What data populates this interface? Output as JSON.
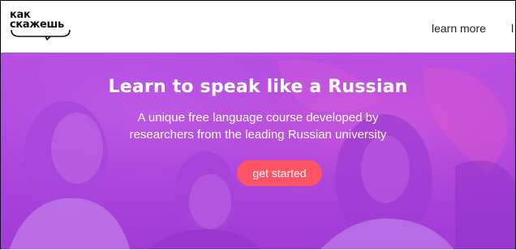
{
  "brand": {
    "logo_line1": "как",
    "logo_line2": "скажешь"
  },
  "nav": {
    "learn_more": "learn more",
    "cut_item": "l"
  },
  "hero": {
    "title": "Learn to speak like a Russian",
    "subtitle_line1": "A unique free language course developed by",
    "subtitle_line2": "researchers from the leading Russian university",
    "cta_label": "get started"
  },
  "colors": {
    "hero_purple": "#b046dc",
    "cta": "#ff5366",
    "text_light": "#ffffff"
  }
}
